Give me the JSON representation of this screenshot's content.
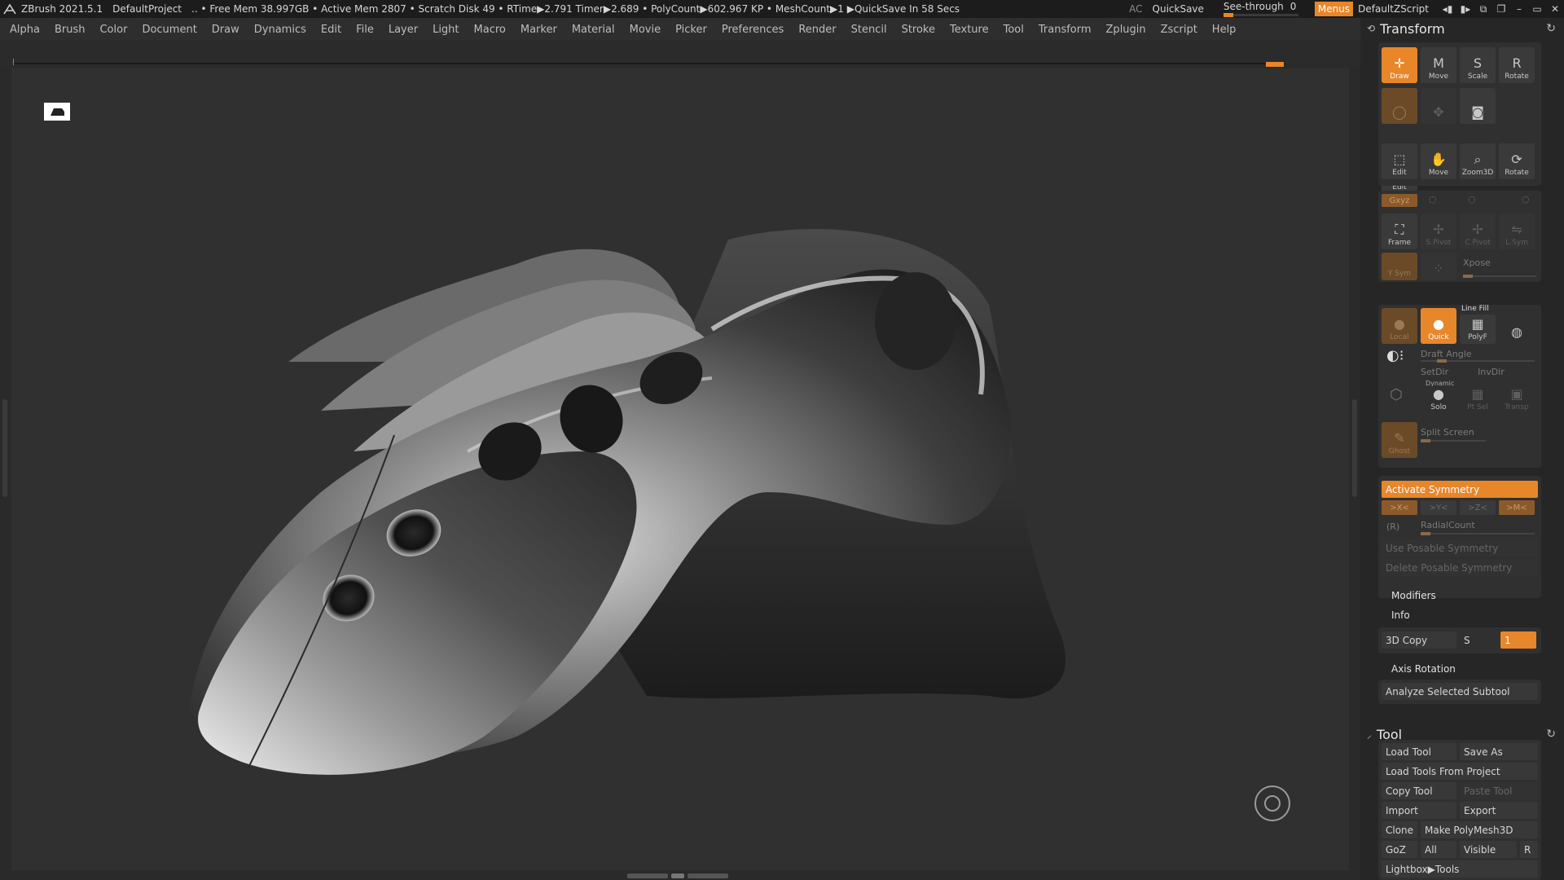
{
  "titlebar": {
    "app": "ZBrush 2021.5.1",
    "project": "DefaultProject",
    "stats": ".. • Free Mem 38.997GB • Active Mem 2807 • Scratch Disk 49 •  RTime▶2.791 Timer▶2.689 • PolyCount▶602.967 KP  • MeshCount▶1  ▶QuickSave In 58 Secs",
    "ac": "AC",
    "quicksave": "QuickSave",
    "seethrough": "See-through",
    "seethrough_value": "0",
    "seethrough_level": 0,
    "menus": "Menus",
    "zscript": "DefaultZScript"
  },
  "menubar": [
    "Alpha",
    "Brush",
    "Color",
    "Document",
    "Draw",
    "Dynamics",
    "Edit",
    "File",
    "Layer",
    "Light",
    "Macro",
    "Marker",
    "Material",
    "Movie",
    "Picker",
    "Preferences",
    "Render",
    "Stencil",
    "Stroke",
    "Texture",
    "Tool",
    "Transform",
    "Zplugin",
    "Zscript",
    "Help"
  ],
  "transform": {
    "title": "Transform",
    "row1": [
      "Draw",
      "Move",
      "Scale",
      "Rotate"
    ],
    "row2b": "Edit",
    "row3": [
      "Edit",
      "Move",
      "Zoom3D",
      "Rotate"
    ],
    "sym_top": [
      "Gxyz"
    ],
    "frame_row": [
      "Frame",
      "S.Pivot",
      "C.Pivot",
      "L.Sym"
    ],
    "xpose_row": [
      "Y Sym",
      "Xpose"
    ],
    "xpose_label": "Xpose",
    "local": "Local",
    "quick": "Quick",
    "polyf": "PolyF",
    "linefill": "Line Fill",
    "draft_angle": "Draft Angle",
    "setdir": "SetDir",
    "invdir": "InvDir",
    "dynamic": "Dynamic",
    "solo": "Solo",
    "ptsel": "Pt Sel",
    "transp": "Transp",
    "ghost": "Ghost",
    "split_screen": "Split Screen",
    "activate_symmetry": "Activate Symmetry",
    "axes": [
      ">X<",
      ">Y<",
      ">Z<",
      ">M<"
    ],
    "r_label": "(R)",
    "radialcount": "RadialCount",
    "use_posable": "Use Posable Symmetry",
    "delete_posable": "Delete Posable Symmetry",
    "modifiers": "Modifiers",
    "info": "Info",
    "copy3d": "3D Copy",
    "s_label": "S",
    "s_value": "1",
    "axis_rotation": "Axis Rotation",
    "analyze": "Analyze Selected Subtool"
  },
  "tool": {
    "title": "Tool",
    "load_tool": "Load Tool",
    "save_as": "Save As",
    "load_from_project": "Load Tools From Project",
    "copy_tool": "Copy Tool",
    "paste_tool": "Paste Tool",
    "import": "Import",
    "export": "Export",
    "clone": "Clone",
    "make_polymesh": "Make PolyMesh3D",
    "goz": "GoZ",
    "all": "All",
    "visible": "Visible",
    "r": "R",
    "lightbox": "Lightbox▶Tools"
  },
  "colors": {
    "accent": "#e8862a",
    "bg": "#2a2a2a",
    "panel": "#262626"
  }
}
